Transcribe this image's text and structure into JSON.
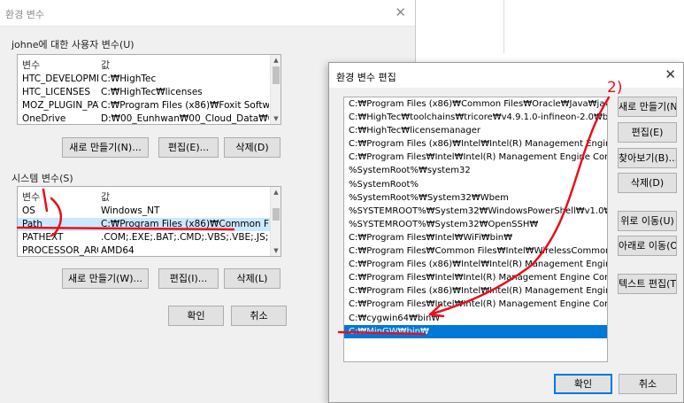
{
  "user_vars_dialog": {
    "title": "환경 변수",
    "user_group_label": "johne에 대한 사용자 변수(U)",
    "columns": {
      "var": "변수",
      "val": "값"
    },
    "user_rows": [
      {
        "name": "HTC_DEVELOPME...",
        "value": "C:₩HighTec"
      },
      {
        "name": "HTC_LICENSES",
        "value": "C:₩HighTec₩licenses"
      },
      {
        "name": "MOZ_PLUGIN_PATH",
        "value": "C:₩Program Files (x86)₩Foxit Software₩Fo..."
      },
      {
        "name": "OneDrive",
        "value": "D:₩00_Eunhwan₩00_Cloud_Data₩00_One..."
      }
    ],
    "user_buttons": {
      "new": "새로 만들기(N)...",
      "edit": "편집(E)...",
      "delete": "삭제(D)"
    },
    "system_group_label": "시스템 변수(S)",
    "system_rows": [
      {
        "name": "OS",
        "value": "Windows_NT"
      },
      {
        "name": "Path",
        "value": "C:₩Program Files (x86)₩Common Files₩Or..."
      },
      {
        "name": "PATHEXT",
        "value": ".COM;.EXE;.BAT;.CMD;.VBS;.VBE;.JS;.JSE;.W..."
      },
      {
        "name": "PROCESSOR_ARC...",
        "value": "AMD64"
      }
    ],
    "system_buttons": {
      "new": "새로 만들기(W)...",
      "edit": "편집(I)...",
      "delete": "삭제(L)"
    },
    "ok": "확인",
    "cancel": "취소"
  },
  "edit_dialog": {
    "title": "환경 변수 편집",
    "paths": [
      "C:₩Program Files (x86)₩Common Files₩Oracle₩Java₩javapath",
      "C:₩HighTec₩toolchains₩tricore₩v4.9.1.0-infineon-2.0₩bin",
      "C:₩HighTec₩licensemanager",
      "C:₩Program Files (x86)₩Intel₩Intel(R) Management Engine Compon...",
      "C:₩Program Files₩Intel₩Intel(R) Management Engine Components₩...",
      "%SystemRoot%₩system32",
      "%SystemRoot%",
      "%SystemRoot%₩System32₩Wbem",
      "%SYSTEMROOT%₩System32₩WindowsPowerShell₩v1.0₩",
      "%SYSTEMROOT%₩System32₩OpenSSH₩",
      "C:₩Program Files₩Intel₩WiFi₩bin₩",
      "C:₩Program Files₩Common Files₩Intel₩WirelessCommon₩",
      "C:₩Program Files (x86)₩Intel₩Intel(R) Management Engine Compon...",
      "C:₩Program Files₩Intel₩Intel(R) Management Engine Components₩...",
      "C:₩Program Files (x86)₩Intel₩Intel(R) Management Engine Compon...",
      "C:₩Program Files₩Intel₩Intel(R) Management Engine Components₩...",
      "C:₩cygwin64₩bin₩",
      "C:₩MinGW₩bin₩"
    ],
    "selected_index": 17,
    "buttons": {
      "new": "새로 만들기(N)",
      "edit": "편집(E)",
      "browse": "찾아보기(B)...",
      "delete": "삭제(D)",
      "move_up": "위로 이동(U)",
      "move_down": "아래로 이동(O)",
      "edit_text": "텍스트 편집(T)..."
    },
    "ok": "확인",
    "cancel": "취소"
  },
  "annotations": {
    "step1": "1",
    "step2": "2)"
  },
  "colors": {
    "selection": "#0078d7",
    "annotation": "#e8101e",
    "row_highlight": "#cce8ff"
  }
}
